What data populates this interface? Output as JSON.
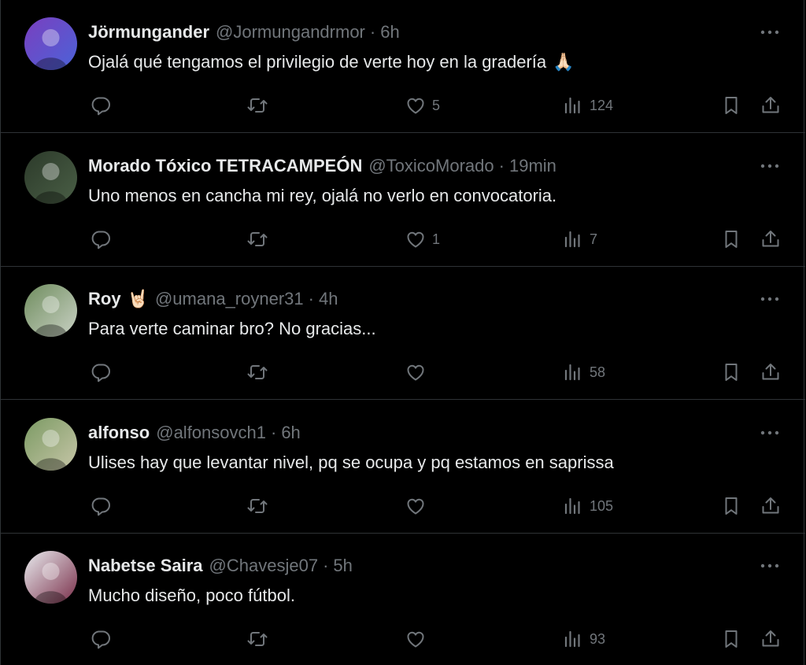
{
  "replies": [
    {
      "name": "Jörmungander",
      "name_emoji": "",
      "handle": "@Jormungandrmor",
      "separator": "·",
      "time": "6h",
      "text": "Ojalá qué tengamos el privilegio de verte hoy en la gradería",
      "text_emoji": "🙏🏻",
      "likes": "5",
      "views": "124",
      "avatar_colors": [
        "#7a3fbf",
        "#4b63d8"
      ]
    },
    {
      "name": "Morado Tóxico TETRACAMPEÓN",
      "name_emoji": "",
      "handle": "@ToxicoMorado",
      "separator": "·",
      "time": "19min",
      "text": "Uno menos en cancha mi rey, ojalá no verlo en convocatoria.",
      "text_emoji": "",
      "likes": "1",
      "views": "7",
      "avatar_colors": [
        "#2c3a2a",
        "#4a5f46"
      ]
    },
    {
      "name": "Roy",
      "name_emoji": "🤘🏻",
      "handle": "@umana_royner31",
      "separator": "·",
      "time": "4h",
      "text": "Para verte caminar bro? No gracias...",
      "text_emoji": "",
      "likes": "",
      "views": "58",
      "avatar_colors": [
        "#6f8d5e",
        "#c9d1c4"
      ]
    },
    {
      "name": "alfonso",
      "name_emoji": "",
      "handle": "@alfonsovch1",
      "separator": "·",
      "time": "6h",
      "text": "Ulises hay que levantar nivel, pq se ocupa y pq estamos en saprissa",
      "text_emoji": "",
      "likes": "",
      "views": "105",
      "avatar_colors": [
        "#7b9a63",
        "#c7c6a8"
      ]
    },
    {
      "name": "Nabetse Saira",
      "name_emoji": "",
      "handle": "@Chavesje07",
      "separator": "·",
      "time": "5h",
      "text": "Mucho diseño, poco fútbol.",
      "text_emoji": "",
      "likes": "",
      "views": "93",
      "avatar_colors": [
        "#e9ecef",
        "#7a2f4a"
      ]
    }
  ],
  "icons": {
    "reply": "reply-icon",
    "retweet": "retweet-icon",
    "like": "heart-icon",
    "views": "views-icon",
    "bookmark": "bookmark-icon",
    "share": "share-icon",
    "more": "more-icon"
  },
  "colors": {
    "background": "#000000",
    "text": "#e7e9ea",
    "secondary": "#71767b",
    "border": "#2f3336"
  }
}
